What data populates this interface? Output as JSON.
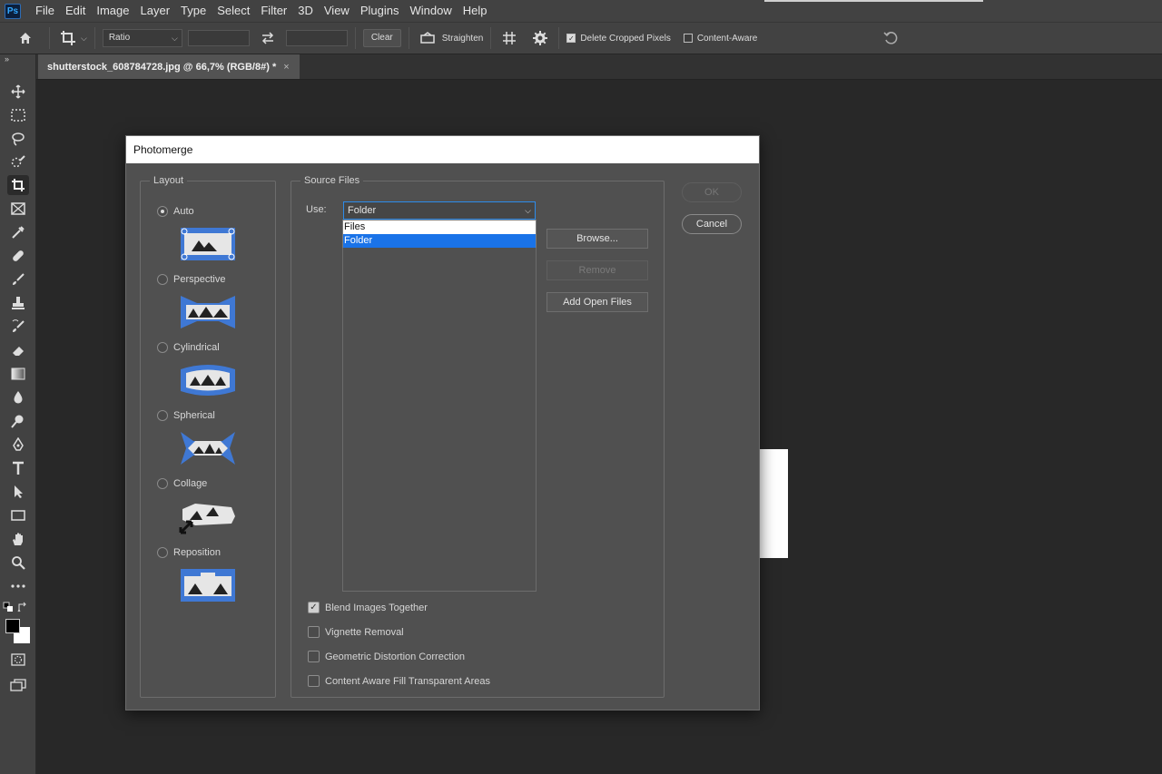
{
  "app": {
    "logo_text": "Ps"
  },
  "menu": [
    "File",
    "Edit",
    "Image",
    "Layer",
    "Type",
    "Select",
    "Filter",
    "3D",
    "View",
    "Plugins",
    "Window",
    "Help"
  ],
  "options_bar": {
    "ratio_label": "Ratio",
    "clear_label": "Clear",
    "straighten_label": "Straighten",
    "delete_cropped_label": "Delete Cropped Pixels",
    "delete_cropped_checked": true,
    "content_aware_label": "Content-Aware",
    "content_aware_checked": false
  },
  "toolbar": {
    "collapse_glyph": "»",
    "tools": [
      "move-tool",
      "marquee-tool",
      "lasso-tool",
      "quick-selection-tool",
      "crop-tool",
      "frame-tool",
      "eyedropper-tool",
      "healing-brush-tool",
      "brush-tool",
      "clone-stamp-tool",
      "history-brush-tool",
      "eraser-tool",
      "gradient-tool",
      "blur-tool",
      "dodge-tool",
      "pen-tool",
      "type-tool",
      "path-selection-tool",
      "rectangle-tool",
      "hand-tool",
      "zoom-tool",
      "more-tools"
    ],
    "active_tool": "crop-tool",
    "foreground_color": "#000000",
    "background_color": "#ffffff"
  },
  "document_tab": {
    "title": "shutterstock_608784728.jpg @ 66,7% (RGB/8#) *",
    "close_glyph": "×"
  },
  "dialog": {
    "title": "Photomerge",
    "layout": {
      "legend": "Layout",
      "options": [
        {
          "label": "Auto",
          "selected": true
        },
        {
          "label": "Perspective",
          "selected": false
        },
        {
          "label": "Cylindrical",
          "selected": false
        },
        {
          "label": "Spherical",
          "selected": false
        },
        {
          "label": "Collage",
          "selected": false
        },
        {
          "label": "Reposition",
          "selected": false
        }
      ]
    },
    "source_files": {
      "legend": "Source Files",
      "use_label": "Use:",
      "use_value": "Folder",
      "dropdown_options": [
        {
          "label": "Files",
          "selected": false
        },
        {
          "label": "Folder",
          "selected": true
        }
      ],
      "browse_label": "Browse...",
      "remove_label": "Remove",
      "add_open_files_label": "Add Open Files"
    },
    "checkboxes": [
      {
        "label": "Blend Images Together",
        "checked": true
      },
      {
        "label": "Vignette Removal",
        "checked": false
      },
      {
        "label": "Geometric Distortion Correction",
        "checked": false
      },
      {
        "label": "Content Aware Fill Transparent Areas",
        "checked": false
      }
    ],
    "ok_label": "OK",
    "cancel_label": "Cancel"
  },
  "colors": {
    "accent": "#2d8ceb",
    "selection": "#1a73e8",
    "layout_icon_blue": "#3f78d4"
  }
}
